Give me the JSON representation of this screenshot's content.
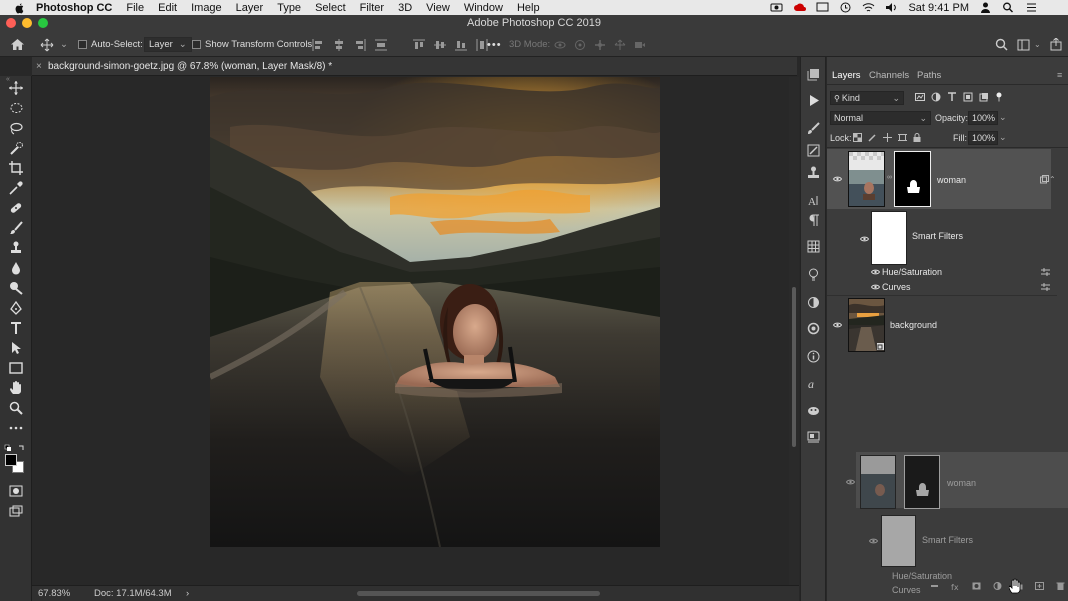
{
  "menubar": {
    "app_name": "Photoshop CC",
    "menus": [
      "File",
      "Edit",
      "Image",
      "Layer",
      "Type",
      "Select",
      "Filter",
      "3D",
      "View",
      "Window",
      "Help"
    ],
    "time": "Sat 9:41 PM"
  },
  "window": {
    "title": "Adobe Photoshop CC 2019"
  },
  "options": {
    "auto_select_label": "Auto-Select:",
    "auto_select_target": "Layer",
    "transform_label": "Show Transform Controls",
    "mode_label": "3D Mode:",
    "more": "•••"
  },
  "document": {
    "tab_close": "×",
    "tab_name": "background-simon-goetz.jpg @ 67.8% (woman, Layer Mask/8) *"
  },
  "status": {
    "zoom": "67.83%",
    "doc": "Doc: 17.1M/64.3M",
    "arrow": "›"
  },
  "layers_panel": {
    "tabs": [
      "Layers",
      "Channels",
      "Paths"
    ],
    "filter_kind": "Kind",
    "blend_mode": "Normal",
    "opacity_label": "Opacity:",
    "opacity_value": "100%",
    "lock_label": "Lock:",
    "fill_label": "Fill:",
    "fill_value": "100%",
    "layers": [
      {
        "name": "woman"
      },
      {
        "name": "Smart Filters"
      },
      {
        "name": "Hue/Saturation"
      },
      {
        "name": "Curves"
      },
      {
        "name": "background"
      }
    ],
    "ghost": {
      "layer": "woman",
      "smart_filters": "Smart Filters",
      "hue_sat": "Hue/Saturation",
      "curves": "Curves"
    }
  },
  "colors": {
    "accent_close": "#fe5f57",
    "accent_min": "#febc2e",
    "accent_max": "#28c840"
  }
}
